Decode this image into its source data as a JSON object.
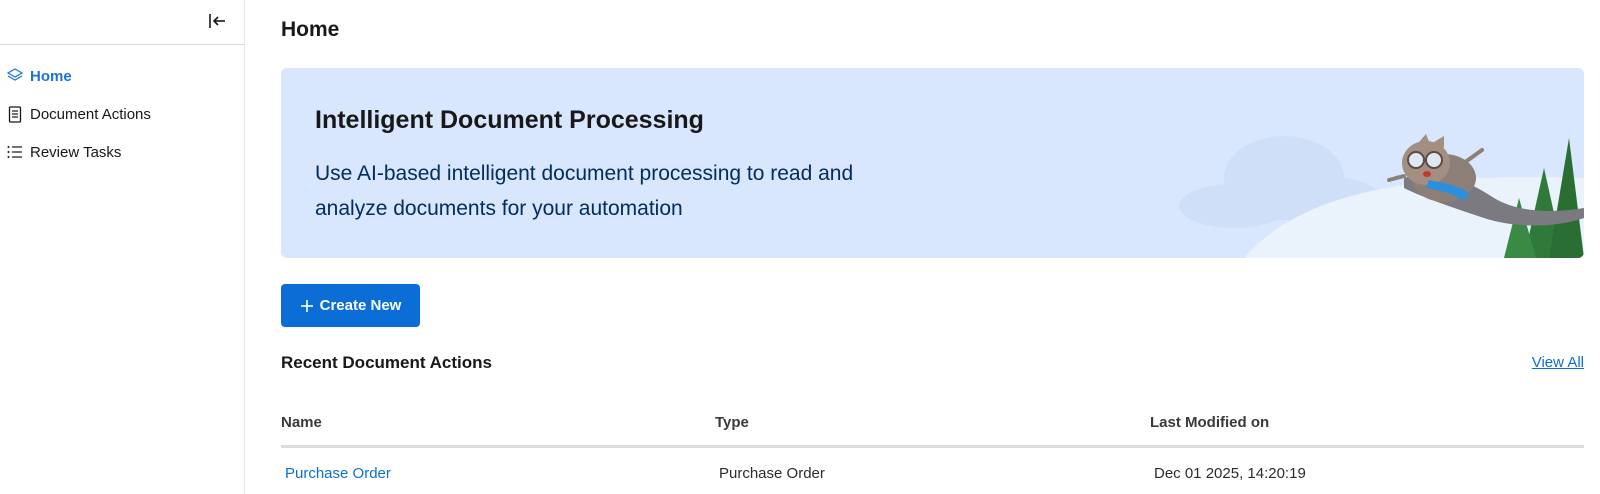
{
  "sidebar": {
    "items": [
      {
        "label": "Home",
        "icon": "layers-icon",
        "active": true
      },
      {
        "label": "Document Actions",
        "icon": "document-icon",
        "active": false
      },
      {
        "label": "Review Tasks",
        "icon": "list-icon",
        "active": false
      }
    ]
  },
  "page": {
    "title": "Home"
  },
  "banner": {
    "title": "Intelligent Document Processing",
    "description": "Use AI-based intelligent document processing to read and analyze documents for your automation"
  },
  "actions": {
    "create_label": "Create New"
  },
  "recent": {
    "title": "Recent Document Actions",
    "view_all": "View All",
    "columns": [
      "Name",
      "Type",
      "Last Modified on"
    ],
    "rows": [
      {
        "name": "Purchase Order",
        "type": "Purchase Order",
        "modified": "Dec 01 2025, 14:20:19"
      }
    ]
  },
  "colors": {
    "accent": "#0b6ed7",
    "banner_bg": "#d8e6fe"
  }
}
